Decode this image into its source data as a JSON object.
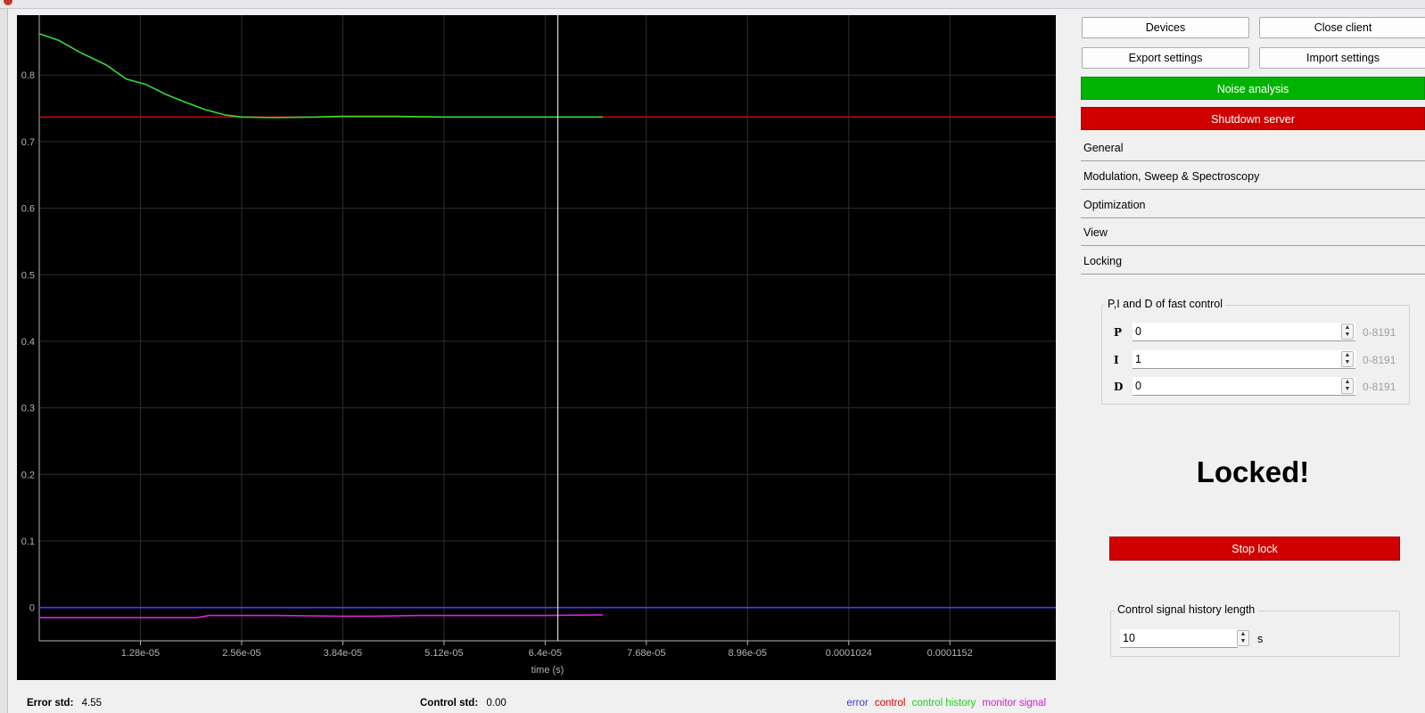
{
  "window": {
    "icon": "app-icon"
  },
  "plot": {
    "xlabel": "time (s)",
    "xticks": [
      "1.28e-05",
      "2.56e-05",
      "3.84e-05",
      "5.12e-05",
      "6.4e-05",
      "7.68e-05",
      "8.96e-05",
      "0.0001024",
      "0.0001152"
    ],
    "yticks": [
      "0",
      "0.1",
      "0.2",
      "0.3",
      "0.4",
      "0.5",
      "0.6",
      "0.7",
      "0.8"
    ]
  },
  "chart_data": {
    "type": "line",
    "xlabel": "time (s)",
    "ylabel": "",
    "xlim": [
      0,
      0.0001286
    ],
    "ylim": [
      -0.05,
      0.89
    ],
    "grid": true,
    "legend_position": "bottom-right",
    "cursor_x": 6.56e-05,
    "series": [
      {
        "name": "error",
        "color": "#4040ff",
        "x": [
          0,
          1.28e-05,
          2.56e-05,
          3.84e-05,
          5.12e-05,
          6.4e-05,
          7.68e-05,
          8.96e-05,
          0.0001024,
          0.0001152,
          0.0001286
        ],
        "y": [
          0,
          0,
          0,
          0,
          0,
          0,
          0,
          0,
          0,
          0,
          0
        ]
      },
      {
        "name": "control",
        "color": "#d00000",
        "x": [
          0,
          0.0001286
        ],
        "y": [
          0.737,
          0.737
        ]
      },
      {
        "name": "control history",
        "color": "#33dd33",
        "x": [
          0,
          2.5e-06,
          5e-06,
          8.5e-06,
          1.1e-05,
          1.35e-05,
          1.6e-05,
          1.85e-05,
          2.1e-05,
          2.35e-05,
          2.56e-05,
          2.95e-05,
          3.5e-05,
          3.84e-05,
          4.5e-05,
          5.12e-05,
          5.8e-05,
          6.4e-05,
          7.13e-05
        ],
        "y": [
          0.862,
          0.852,
          0.835,
          0.815,
          0.794,
          0.786,
          0.771,
          0.759,
          0.748,
          0.74,
          0.737,
          0.736,
          0.737,
          0.738,
          0.738,
          0.737,
          0.737,
          0.737,
          0.737
        ]
      },
      {
        "name": "monitor signal",
        "color": "#dd22dd",
        "x": [
          0,
          5e-06,
          1e-05,
          1.5e-05,
          2e-05,
          2.15e-05,
          2.5e-05,
          3e-05,
          3.84e-05,
          4.2e-05,
          4.8e-05,
          5.12e-05,
          5.8e-05,
          6.4e-05,
          7.13e-05
        ],
        "y": [
          -0.015,
          -0.015,
          -0.015,
          -0.015,
          -0.015,
          -0.012,
          -0.012,
          -0.012,
          -0.013,
          -0.013,
          -0.012,
          -0.012,
          -0.012,
          -0.012,
          -0.011
        ]
      }
    ]
  },
  "footer": {
    "error_std_label": "Error std:",
    "error_std_value": "4.55",
    "control_std_label": "Control std:",
    "control_std_value": "0.00",
    "legend": [
      {
        "label": "error",
        "color": "#3a3ad8"
      },
      {
        "label": "control",
        "color": "#d00000"
      },
      {
        "label": "control history",
        "color": "#22cc22"
      },
      {
        "label": "monitor signal",
        "color": "#cc22cc"
      }
    ]
  },
  "buttons": {
    "devices": "Devices",
    "close_client": "Close client",
    "export_settings": "Export settings",
    "import_settings": "Import settings",
    "noise_analysis": "Noise analysis",
    "shutdown_server": "Shutdown server"
  },
  "colors": {
    "green_button": "#00b300",
    "red_button": "#d00000"
  },
  "sections": [
    "General",
    "Modulation, Sweep & Spectroscopy",
    "Optimization",
    "View",
    "Locking"
  ],
  "pid": {
    "title": "P,I and D  of fast control",
    "rows": [
      {
        "label": "P",
        "value": "0",
        "range": "0-8191"
      },
      {
        "label": "I",
        "value": "1",
        "range": "0-8191"
      },
      {
        "label": "D",
        "value": "0",
        "range": "0-8191"
      }
    ]
  },
  "status": {
    "text": "Locked!"
  },
  "stop_lock": "Stop lock",
  "history": {
    "title": "Control signal history length",
    "value": "10",
    "unit": "s"
  }
}
